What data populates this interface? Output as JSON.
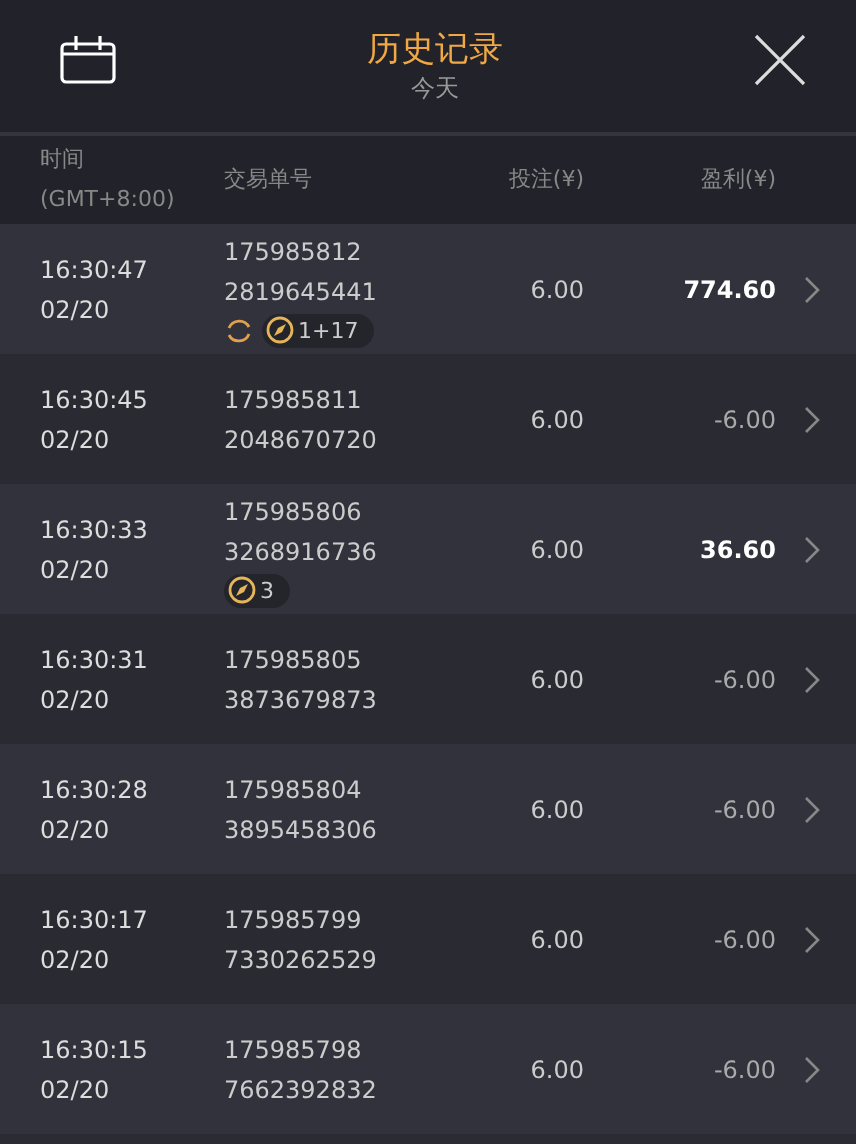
{
  "header": {
    "title": "历史记录",
    "subtitle": "今天"
  },
  "columns": [
    {
      "label": "时间",
      "sublabel": "(GMT+8:00)"
    },
    {
      "label": "交易单号"
    },
    {
      "label": "投注(¥)"
    },
    {
      "label": "盈利(¥)"
    }
  ],
  "rows": [
    {
      "time": "16:30:47",
      "date": "02/20",
      "order_1": "175985812",
      "order_2": "2819645441",
      "stake": "6.00",
      "profit": "774.60",
      "won": true,
      "tags": [
        {
          "kind": "cycle"
        },
        {
          "kind": "count",
          "text": "1+17"
        }
      ]
    },
    {
      "time": "16:30:45",
      "date": "02/20",
      "order_1": "175985811",
      "order_2": "2048670720",
      "stake": "6.00",
      "profit": "-6.00",
      "won": false
    },
    {
      "time": "16:30:33",
      "date": "02/20",
      "order_1": "175985806",
      "order_2": "3268916736",
      "stake": "6.00",
      "profit": "36.60",
      "won": true,
      "tags": [
        {
          "kind": "count",
          "text": "3"
        }
      ]
    },
    {
      "time": "16:30:31",
      "date": "02/20",
      "order_1": "175985805",
      "order_2": "3873679873",
      "stake": "6.00",
      "profit": "-6.00",
      "won": false
    },
    {
      "time": "16:30:28",
      "date": "02/20",
      "order_1": "175985804",
      "order_2": "3895458306",
      "stake": "6.00",
      "profit": "-6.00",
      "won": false
    },
    {
      "time": "16:30:17",
      "date": "02/20",
      "order_1": "175985799",
      "order_2": "7330262529",
      "stake": "6.00",
      "profit": "-6.00",
      "won": false
    },
    {
      "time": "16:30:15",
      "date": "02/20",
      "order_1": "175985798",
      "order_2": "7662392832",
      "stake": "6.00",
      "profit": "-6.00",
      "won": false
    }
  ]
}
